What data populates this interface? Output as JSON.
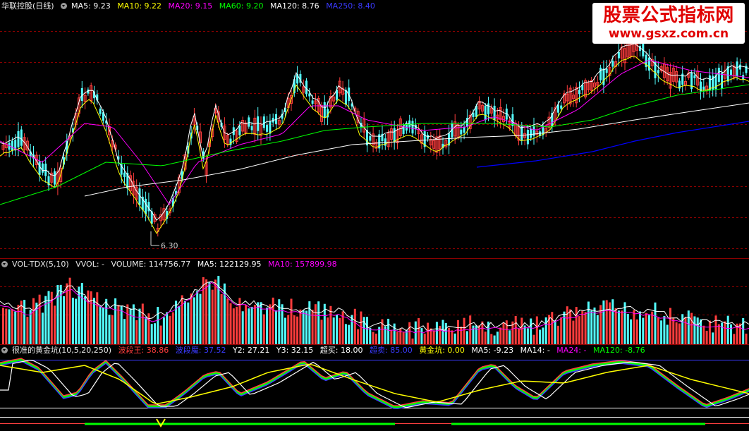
{
  "price_header": {
    "title": "华联控股(日线)",
    "ma5": "MA5: 9.23",
    "ma10": "MA10: 9.22",
    "ma20": "MA20: 9.15",
    "ma60": "MA60: 9.20",
    "ma120": "MA120: 8.76",
    "ma250": "MA250: 8.40"
  },
  "price_low_label": "6.30",
  "vol_header": {
    "title": "VOL-TDX(5,10)",
    "vvol": "VVOL: -",
    "volume": "VOLUME: 114756.77",
    "ma5": "MA5: 122129.95",
    "ma10": "MA10: 157899.98"
  },
  "ind_header": {
    "title": "很准的黄金坑(10,5,20,250)",
    "bdw": "波段王: 38.86",
    "bdm": "波段魔: 37.52",
    "y2": "Y2: 27.21",
    "y3": "Y3: 32.15",
    "overbuy": "超买: 18.00",
    "oversell": "超卖: 85.00",
    "pit": "黄金坑: 0.00",
    "ma5": "MA5: -9.23",
    "ma14": "MA14: -",
    "ma24": "MA24: -",
    "ma120": "MA120: -8.76"
  },
  "watermark": {
    "title": "股票公式指标网",
    "url": "www.gsxz.com.cn"
  },
  "colors": {
    "up": "#ff3c3c",
    "down": "#54ffff",
    "ma5": "#ffffff",
    "ma10": "#ffff00",
    "ma20": "#ff00ff",
    "ma60": "#00ff00",
    "ma120": "#ffffff",
    "ma250": "#0000ff",
    "grid": "#8b0000"
  }
}
